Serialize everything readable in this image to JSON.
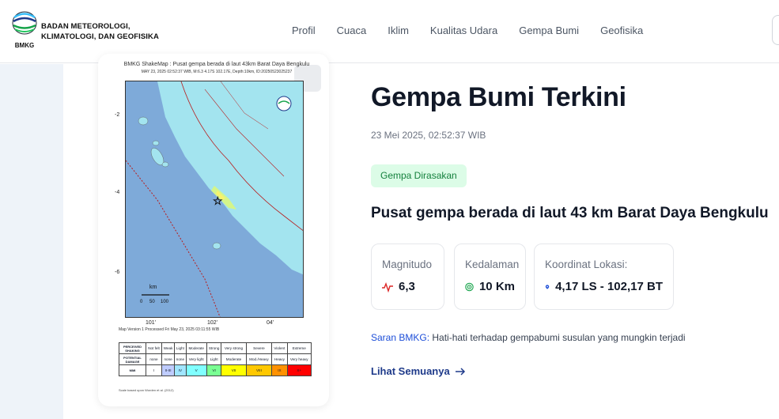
{
  "header": {
    "org_line1": "BADAN METEOROLOGI,",
    "org_line2": "KLIMATOLOGI, DAN GEOFISIKA",
    "logo_abbrev": "BMKG",
    "nav": [
      "Profil",
      "Cuaca",
      "Iklim",
      "Kualitas Udara",
      "Gempa Bumi",
      "Geofisika"
    ]
  },
  "map": {
    "header_line1": "BMKG ShakeMap : Pusat gempa berada di laut 43km Barat Daya Bengkulu",
    "header_line2": "MAY 23, 2025 02:52:37 WIB, M:6.3 4.17S 102.17E, Depth:10km, ID:20250523025237",
    "lat_ticks": [
      "-2",
      "-4",
      "-6"
    ],
    "lon_ticks": [
      "101'",
      "102'",
      "04'"
    ],
    "scale_label": "km",
    "scale_ticks": [
      "0",
      "50",
      "100"
    ],
    "footer_line": "Map Version 1 Processed Fri May 23, 2025 03:11:55 WIB",
    "mmi_rows": {
      "perceived_shaking": "PERCEIVED SHAKING",
      "potential_damage": "POTENTIAL DAMAGE",
      "mmi": "MMI"
    },
    "mmi_scale": [
      {
        "shaking": "Not felt",
        "damage": "none",
        "mmi": "I",
        "color": "#ffffff"
      },
      {
        "shaking": "Weak",
        "damage": "none",
        "mmi": "II-III",
        "color": "#bfccff"
      },
      {
        "shaking": "Light",
        "damage": "none",
        "mmi": "IV",
        "color": "#a0e6ff"
      },
      {
        "shaking": "Moderate",
        "damage": "Very light",
        "mmi": "V",
        "color": "#80ffff"
      },
      {
        "shaking": "Strong",
        "damage": "Light",
        "mmi": "VI",
        "color": "#7aff93"
      },
      {
        "shaking": "Very strong",
        "damage": "Moderate",
        "mmi": "VII",
        "color": "#ffff00"
      },
      {
        "shaking": "Severe",
        "damage": "Mod./Heavy",
        "mmi": "VIII",
        "color": "#ffc800"
      },
      {
        "shaking": "Violent",
        "damage": "Heavy",
        "mmi": "IX",
        "color": "#ff9100"
      },
      {
        "shaking": "Extreme",
        "damage": "Very heavy",
        "mmi": "X+",
        "color": "#ff0000"
      }
    ],
    "credit": "Scale based upon Worden et al. (2012)"
  },
  "quake": {
    "title": "Gempa Bumi Terkini",
    "datetime": "23 Mei 2025, 02:52:37 WIB",
    "badge": "Gempa Dirasakan",
    "headline": "Pusat gempa berada di laut 43 km Barat Daya Bengkulu",
    "magnitude_label": "Magnitudo",
    "magnitude_value": "6,3",
    "depth_label": "Kedalaman",
    "depth_value": "10 Km",
    "coord_label": "Koordinat Lokasi:",
    "coord_value": "4,17 LS - 102,17 BT",
    "advice_label": "Saran BMKG:",
    "advice_text": " Hati-hati terhadap gempabumi susulan yang mungkin terjadi",
    "see_all": "Lihat Semuanya"
  },
  "colors": {
    "accent_blue": "#1e3a8a",
    "badge_green": "#15803d",
    "magnitude_red": "#dc2626",
    "depth_green": "#16a34a",
    "pin_blue": "#1d4ed8"
  }
}
